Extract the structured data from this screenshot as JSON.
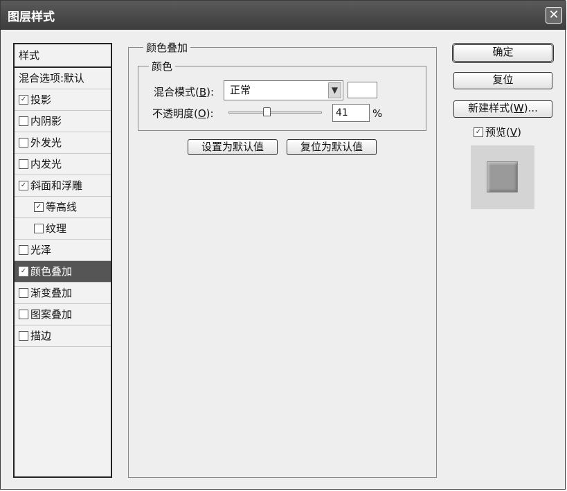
{
  "window": {
    "title": "图层样式",
    "close_glyph": "✕"
  },
  "style_list": {
    "header": "样式",
    "items": [
      {
        "label": "混合选项:默认",
        "has_checkbox": false,
        "checked": false,
        "indent": false,
        "selected": false
      },
      {
        "label": "投影",
        "has_checkbox": true,
        "checked": true,
        "indent": false,
        "selected": false
      },
      {
        "label": "内阴影",
        "has_checkbox": true,
        "checked": false,
        "indent": false,
        "selected": false
      },
      {
        "label": "外发光",
        "has_checkbox": true,
        "checked": false,
        "indent": false,
        "selected": false
      },
      {
        "label": "内发光",
        "has_checkbox": true,
        "checked": false,
        "indent": false,
        "selected": false
      },
      {
        "label": "斜面和浮雕",
        "has_checkbox": true,
        "checked": true,
        "indent": false,
        "selected": false
      },
      {
        "label": "等高线",
        "has_checkbox": true,
        "checked": true,
        "indent": true,
        "selected": false
      },
      {
        "label": "纹理",
        "has_checkbox": true,
        "checked": false,
        "indent": true,
        "selected": false
      },
      {
        "label": "光泽",
        "has_checkbox": true,
        "checked": false,
        "indent": false,
        "selected": false
      },
      {
        "label": "颜色叠加",
        "has_checkbox": true,
        "checked": true,
        "indent": false,
        "selected": true
      },
      {
        "label": "渐变叠加",
        "has_checkbox": true,
        "checked": false,
        "indent": false,
        "selected": false
      },
      {
        "label": "图案叠加",
        "has_checkbox": true,
        "checked": false,
        "indent": false,
        "selected": false
      },
      {
        "label": "描边",
        "has_checkbox": true,
        "checked": false,
        "indent": false,
        "selected": false
      }
    ]
  },
  "panel": {
    "title": "颜色叠加",
    "group_title": "颜色",
    "blend_mode_label_pre": "混合模式(",
    "blend_mode_key": "B",
    "blend_mode_label_post": "):",
    "blend_mode_value": "正常",
    "dropdown_arrow": "▼",
    "swatch_color": "#ffffff",
    "opacity_label_pre": "不透明度(",
    "opacity_key": "O",
    "opacity_label_post": "):",
    "opacity_value": "41",
    "opacity_unit": "%",
    "slider_level": 0.41,
    "set_default_button": "设置为默认值",
    "reset_default_button": "复位为默认值"
  },
  "actions": {
    "ok": "确定",
    "reset": "复位",
    "new_style_pre": "新建样式(",
    "new_style_key": "W",
    "new_style_post": ")...",
    "preview_pre": "预览(",
    "preview_key": "V",
    "preview_post": ")",
    "preview_checked": true
  },
  "colors": {
    "titlebar": "#454545",
    "dialog_bg": "#eeeeee",
    "selected_row": "#555555",
    "preview_swatch": "#9a9a9a"
  }
}
